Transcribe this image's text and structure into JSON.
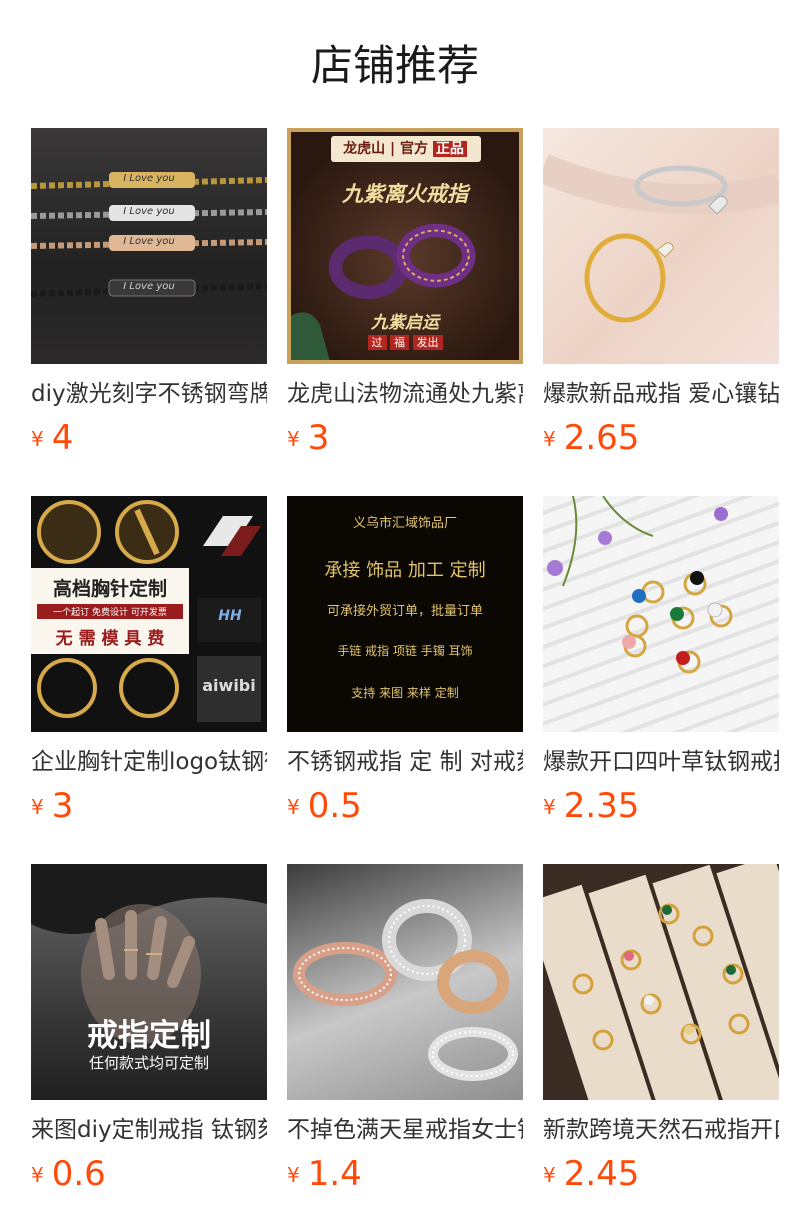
{
  "section_title": "店铺推荐",
  "currency_symbol": "¥",
  "products": [
    {
      "name": "diy激光刻字不锈钢弯牌手链",
      "price": "4",
      "thumb": {
        "bar_text": "I Love you"
      }
    },
    {
      "name": "龙虎山法物流通处九紫离火戒指",
      "price": "3",
      "thumb": {
        "brand": "龙虎山",
        "official": "官方",
        "genuine": "正品",
        "headline": "九紫离火戒指",
        "slogan": "九紫启运",
        "tags": [
          "过",
          "福",
          "发出"
        ]
      }
    },
    {
      "name": "爆款新品戒指 爱心镶钻开口戒",
      "price": "2.65",
      "thumb": {}
    },
    {
      "name": "企业胸针定制logo钛钢徽章",
      "price": "3",
      "thumb": {
        "headline": "高档胸针定制",
        "sub": "一个起订 免费设计 可开发票",
        "footer": "无 需 模 具 费",
        "logo_text": "aiwibi",
        "hh": "HH"
      }
    },
    {
      "name": "不锈钢戒指 定 制 对戒刻字",
      "price": "0.5",
      "thumb": {
        "lines": [
          "义乌市汇域饰品厂",
          "承接 饰品 加工 定制",
          "可承接外贸订单，批量订单",
          "手链 戒指 项链 手镯 耳饰",
          "支持 来图 来样 定制"
        ]
      }
    },
    {
      "name": "爆款开口四叶草钛钢戒指",
      "price": "2.35",
      "thumb": {}
    },
    {
      "name": "来图diy定制戒指 钛钢刻字",
      "price": "0.6",
      "thumb": {
        "headline": "戒指定制",
        "sub": "任何款式均可定制"
      }
    },
    {
      "name": "不掉色满天星戒指女士钛钢",
      "price": "1.4",
      "thumb": {}
    },
    {
      "name": "新款跨境天然石戒指开口",
      "price": "2.45",
      "thumb": {}
    }
  ]
}
